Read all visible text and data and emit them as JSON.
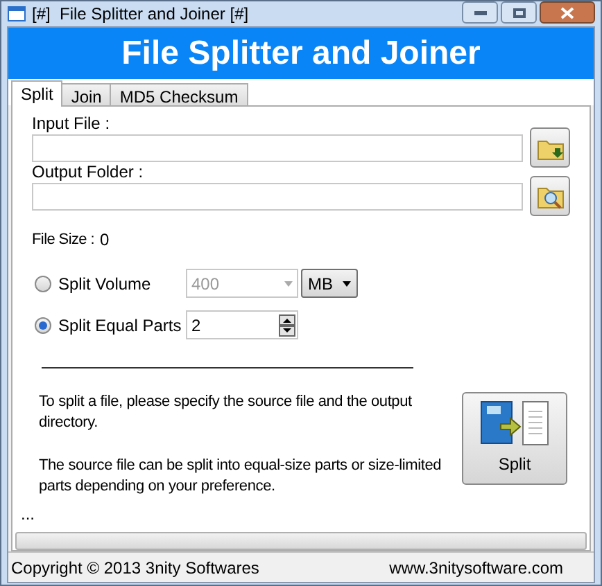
{
  "window": {
    "title": "[#]  File Splitter and Joiner [#]"
  },
  "banner": "File Splitter and Joiner",
  "tabs": [
    {
      "label": "Split",
      "selected": true
    },
    {
      "label": "Join",
      "selected": false
    },
    {
      "label": "MD5 Checksum",
      "selected": false
    }
  ],
  "input_file": {
    "label": "Input File :"
  },
  "output_folder": {
    "label": "Output Folder :"
  },
  "file_size": {
    "label": "File Size :",
    "value": "0"
  },
  "options": [
    {
      "label": "Split Volume",
      "selected": false,
      "value": "400",
      "unit": "MB",
      "kind": "volume"
    },
    {
      "label": "Split Equal Parts",
      "selected": true,
      "value": "2",
      "kind": "parts"
    }
  ],
  "info": [
    "To split a file, please specify the source file and the output directory.",
    "The source file can be split into equal-size parts or size-limited parts depending on your preference."
  ],
  "split_button": "Split",
  "status_text": "...",
  "progress": {
    "level": 0
  },
  "status_bar": {
    "left": "Copyright © 2013 3nity Softwares",
    "right": "www.3nitysoftware.com"
  }
}
